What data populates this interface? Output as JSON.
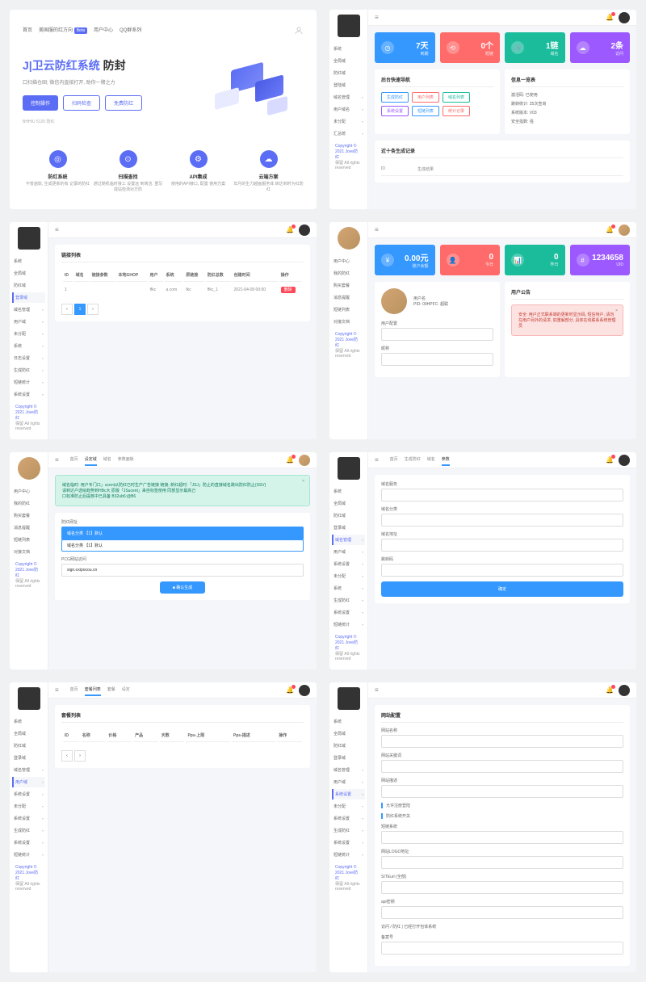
{
  "panel1": {
    "nav": [
      "首页",
      "美国服的红方向",
      "用户中心",
      "QQ群系列"
    ],
    "beta": "Beta",
    "title_prefix": "J|卫云防红系统",
    "title_suffix": "防封",
    "subtitle": "口扫描仓固; 微信内直接打开, 助你一臂之力",
    "btn_primary": "控制操作",
    "btn_outline1": "扫码检查",
    "btn_outline2": "免费防红",
    "note": "BHHIU 5120 防红",
    "features": [
      {
        "icon": "◎",
        "title": "防红系统",
        "desc": "不普遍软, 生成更新的有\n记录的防红"
      },
      {
        "icon": "⊙",
        "title": "扫描查找",
        "desc": "通过随机临时接工 设置远\n到简洁, 重写成站检测对方防"
      },
      {
        "icon": "⚙",
        "title": "API集成",
        "desc": "使用的API接口, 配置\n使用方案"
      },
      {
        "icon": "☁",
        "title": "云端方案",
        "desc": "年月的生力越画服务体\n转达到时为红防红"
      }
    ]
  },
  "panel2": {
    "side": [
      "系统",
      "全局域",
      "防红域",
      "登陆域",
      "域名管理",
      "用户域名",
      "未分配",
      "汇总统"
    ],
    "cards": [
      {
        "num": "7天",
        "lbl": "到期"
      },
      {
        "num": "0个",
        "lbl": "短链"
      },
      {
        "num": "1链",
        "lbl": "域名"
      },
      {
        "num": "2条",
        "lbl": "访问"
      }
    ],
    "box1_title": "后台快速导航",
    "quicklinks": [
      [
        "生成防红",
        "用户列表",
        "域名列表"
      ],
      [
        "系统设置",
        "短链列表",
        "统计记录"
      ]
    ],
    "box2_title": "信息一览表",
    "info": [
      "激活码: 已使用",
      "跳转统计: 25次查询",
      "系统版本: V03",
      "安全指数: 强"
    ],
    "log_title": "近十条生成记录",
    "log_head": [
      "ID",
      "生成结果"
    ]
  },
  "panel3": {
    "side": [
      "系统",
      "全局域",
      "防红域",
      "登录域",
      "域名管理",
      "用户域",
      "未分配",
      "系统",
      "日志设置",
      "生成防红",
      "短链统计",
      "系统设置"
    ],
    "card_title": "链接列表",
    "table_head": [
      "ID",
      "域名",
      "链接参数",
      "本地GHOP",
      "用户",
      "系统",
      "原链接",
      "防红总数",
      "创建时间",
      "操作"
    ],
    "table_row": [
      "1",
      "",
      "",
      "",
      "ffkc",
      "a.com",
      "fkc",
      "ffkc_1",
      "2021-04-09 00:00",
      ""
    ]
  },
  "panel4": {
    "side": [
      "用户中心",
      "我的防红",
      "购买套餐",
      "消息提醒",
      "短链列表",
      "对接文档"
    ],
    "cards": [
      {
        "num": "0.00元",
        "lbl": "账户余额"
      },
      {
        "num": "0",
        "lbl": "今日"
      },
      {
        "num": "0",
        "lbl": "昨日"
      },
      {
        "num": "1234658",
        "lbl": "UID"
      }
    ],
    "prof_name": "用户名",
    "prof_id": "PID: 09HPFC: 超联",
    "alert": "安全: 用户正式联系端的更新时显示码, 短信待户, 请勿在用户另外的请求, 如重解部分, 具体在线联系系统管理员",
    "form_labels": [
      "用户配置",
      "昵称"
    ]
  },
  "panel5": {
    "tabs": [
      "首页",
      "设定域",
      "域名",
      "参数面板"
    ],
    "alert_lines": [
      "域名临时: 用户专门口」ucent从防红已时生产广告链接 链接, 新红超时:「JSJ」防止的直接域名跳出防红防止(SSV)",
      "请到达户选绘趋势到HBc大 原版「JSucent」来自标签使用 同部显示最高己",
      "口标准防止后提核中已具备 B32ub6:@B6"
    ],
    "form_label": "防红网址",
    "select_value": "域名分类 【1】默认",
    "dd_items": [
      "域名分类 【1】默认"
    ],
    "other_label": "PCG网站访问",
    "other_value": "sign.oxipocou.cn",
    "submit": "■ 确认生成"
  },
  "panel6": {
    "tabs": [
      "首页",
      "生成防红",
      "域名",
      "参数"
    ],
    "side": [
      "系统",
      "全局域",
      "防红域",
      "登录域",
      "域名管理",
      "用户域",
      "系统设置",
      "未分配",
      "系统",
      "生成防红",
      "系统设置",
      "短链统计"
    ],
    "labels": [
      "域名服务",
      "域名分类",
      "域名地址",
      "跳转码"
    ],
    "submit": "确定"
  },
  "panel7": {
    "tabs": [
      "首页",
      "套餐列表",
      "套餐",
      "设定"
    ],
    "side": [
      "系统",
      "全局域",
      "防红域",
      "登录域",
      "域名管理",
      "用户域",
      "系统设置",
      "未分配",
      "系统设置",
      "生成防红",
      "系统设置",
      "短链统计"
    ],
    "card_title": "套餐列表",
    "table_head": [
      "ID",
      "名称",
      "价格",
      "产品",
      "天数",
      "Pps-上限",
      "Pps-描述",
      "操作"
    ]
  },
  "panel8": {
    "side": [
      "系统",
      "全局域",
      "防红域",
      "登录域",
      "域名管理",
      "用户域",
      "系统设置",
      "未分配",
      "系统设置",
      "生成防红",
      "系统设置",
      "短链统计"
    ],
    "card_title": "网站配置",
    "labels": [
      "网站名称",
      "网站关键词",
      "网站描述",
      "允许注册登陆",
      "防红系统开关",
      "短链系统",
      "网站LOGO地址",
      "SITEurl (全部)",
      "api密钥",
      "访问 / 防红 | 已经打开包体系统",
      "备案号"
    ]
  },
  "footer": {
    "copy": "Copyright © 2021 Jove防红",
    "res": "保留 All rights reserved"
  }
}
